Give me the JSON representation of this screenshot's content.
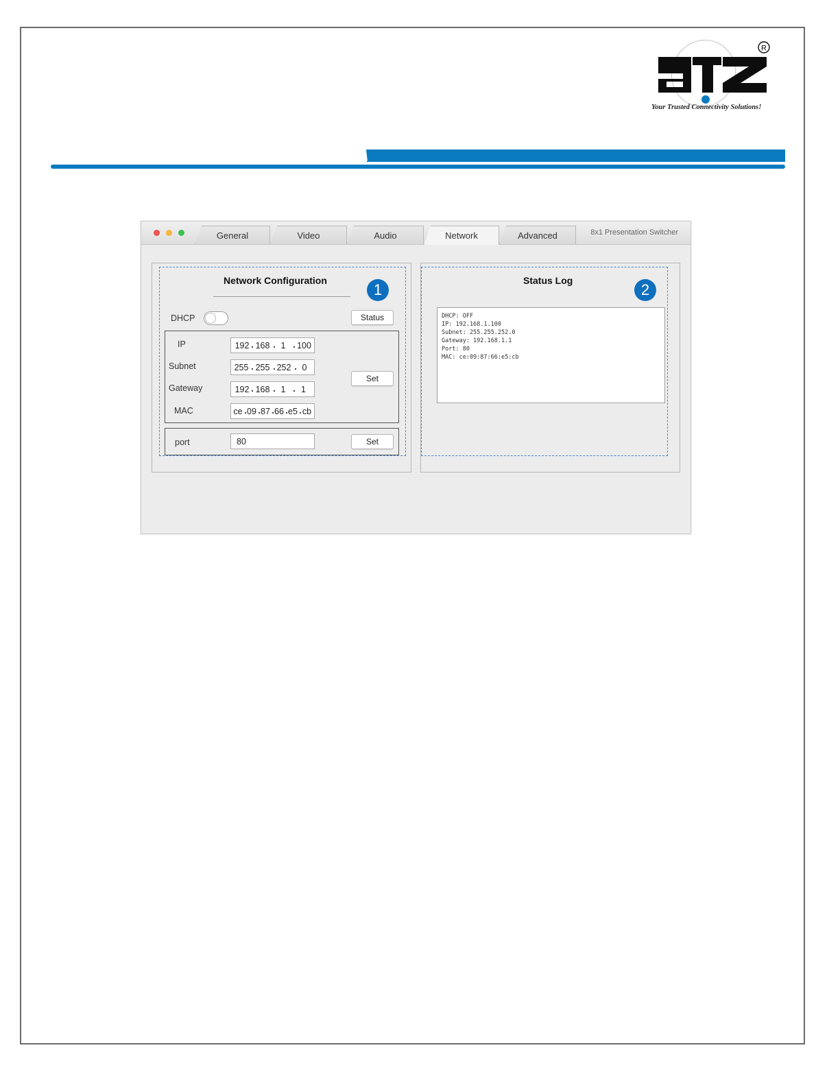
{
  "logo": {
    "text": "aTZ",
    "registered": "®",
    "tagline": "Your Trusted Connectivity Solutions!",
    "colors": {
      "brand_blue": "#0a7ac0",
      "logo_black": "#0d0d0d"
    }
  },
  "window": {
    "title": "8x1 Presentation Switcher",
    "tabs": [
      {
        "label": "General"
      },
      {
        "label": "Video"
      },
      {
        "label": "Audio"
      },
      {
        "label": "Network",
        "active": true
      },
      {
        "label": "Advanced"
      }
    ]
  },
  "network_config": {
    "title": "Network Configuration",
    "badge": "1",
    "dhcp_label": "DHCP",
    "dhcp_on": false,
    "status_button": "Status",
    "ip_label": "IP",
    "ip": [
      "192",
      "168",
      "1",
      "100"
    ],
    "subnet_label": "Subnet",
    "subnet": [
      "255",
      "255",
      "252",
      "0"
    ],
    "gateway_label": "Gateway",
    "gateway": [
      "192",
      "168",
      "1",
      "1"
    ],
    "mac_label": "MAC",
    "mac": [
      "ce",
      "09",
      "87",
      "66",
      "e5",
      "cb"
    ],
    "set_button": "Set",
    "port_label": "port",
    "port_value": "80",
    "port_set_button": "Set"
  },
  "status_log": {
    "title": "Status Log",
    "badge": "2",
    "lines": [
      "DHCP: OFF",
      "IP: 192.168.1.100",
      "Subnet: 255.255.252.0",
      "Gateway: 192.168.1.1",
      "Port: 80",
      "MAC: ce:09:87:66:e5:cb"
    ]
  }
}
